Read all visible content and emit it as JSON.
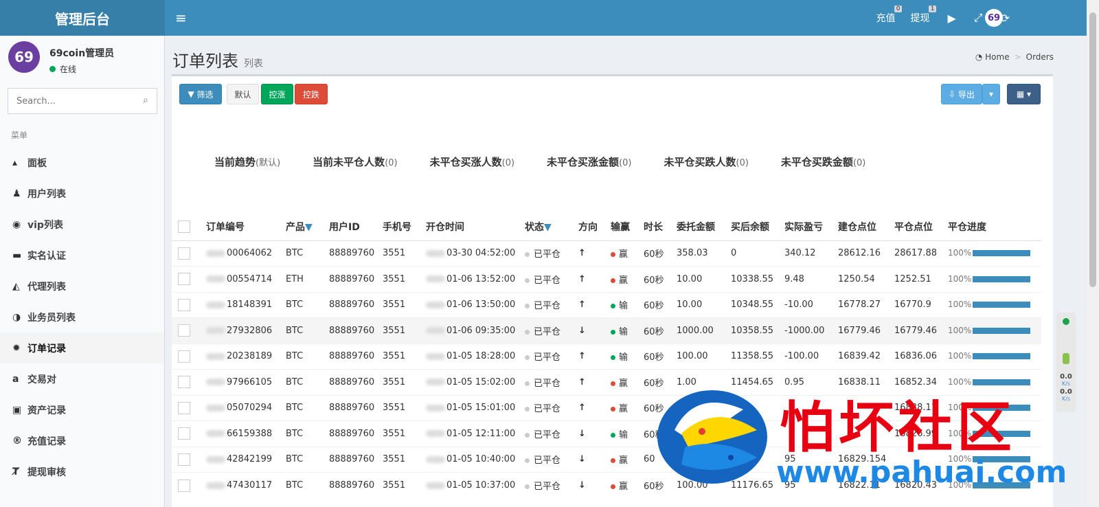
{
  "brand": "管理后台",
  "topnav": {
    "recharge_label": "充值",
    "recharge_badge": "0",
    "withdraw_label": "提现",
    "withdraw_badge": "1",
    "avatar": "69"
  },
  "user": {
    "avatar": "69",
    "name": "69coin管理员",
    "status": "在线"
  },
  "search": {
    "placeholder": "Search..."
  },
  "menu_header": "菜单",
  "menu": [
    {
      "label": "面板",
      "icon": "area-chart-icon"
    },
    {
      "label": "用户列表",
      "icon": "users-icon"
    },
    {
      "label": "vip列表",
      "icon": "chevron-circle-icon"
    },
    {
      "label": "实名认证",
      "icon": "id-card-icon"
    },
    {
      "label": "代理列表",
      "icon": "arrow-circle-up-icon"
    },
    {
      "label": "业务员列表",
      "icon": "half-circle-icon"
    },
    {
      "label": "订单记录",
      "icon": "gear-icon"
    },
    {
      "label": "交易对",
      "icon": "amazon-icon"
    },
    {
      "label": "资产记录",
      "icon": "money-icon"
    },
    {
      "label": "充值记录",
      "icon": "registered-icon"
    },
    {
      "label": "提现审核",
      "icon": "text-height-icon"
    }
  ],
  "page": {
    "title": "订单列表",
    "subtitle": "列表"
  },
  "breadcrumb": {
    "home": "Home",
    "current": "Orders"
  },
  "toolbar": {
    "filter": "筛选",
    "default": "默认",
    "up": "控涨",
    "down": "控跌",
    "export": "导出"
  },
  "stats": [
    {
      "label": "当前趋势",
      "value": "(默认)"
    },
    {
      "label": "当前未平仓人数",
      "value": "(0)"
    },
    {
      "label": "未平仓买涨人数",
      "value": "(0)"
    },
    {
      "label": "未平仓买涨金额",
      "value": "(0)"
    },
    {
      "label": "未平仓买跌人数",
      "value": "(0)"
    },
    {
      "label": "未平仓买跌金额",
      "value": "(0)"
    }
  ],
  "table": {
    "headers": [
      "订单编号",
      "产品",
      "用户ID",
      "手机号",
      "开仓时间",
      "状态",
      "方向",
      "输赢",
      "时长",
      "委托金额",
      "买后余额",
      "实际盈亏",
      "建仓点位",
      "平仓点位",
      "平仓进度"
    ],
    "rows": [
      {
        "id": "00064062",
        "product": "BTC",
        "uid": "88889760",
        "phone": "3551",
        "time": "03-30 04:52:00",
        "status": "已平仓",
        "dir": "↑",
        "result": "赢",
        "dur": "60秒",
        "amount": "358.03",
        "balance": "0",
        "pnl": "340.12",
        "open": "28612.16",
        "close": "28617.88",
        "progress": "100%"
      },
      {
        "id": "00554714",
        "product": "ETH",
        "uid": "88889760",
        "phone": "3551",
        "time": "01-06 13:52:00",
        "status": "已平仓",
        "dir": "↑",
        "result": "赢",
        "dur": "60秒",
        "amount": "10.00",
        "balance": "10338.55",
        "pnl": "9.48",
        "open": "1250.54",
        "close": "1252.51",
        "progress": "100%"
      },
      {
        "id": "18148391",
        "product": "BTC",
        "uid": "88889760",
        "phone": "3551",
        "time": "01-06 13:50:00",
        "status": "已平仓",
        "dir": "↑",
        "result": "输",
        "dur": "60秒",
        "amount": "10.00",
        "balance": "10348.55",
        "pnl": "-10.00",
        "open": "16778.27",
        "close": "16770.9",
        "progress": "100%"
      },
      {
        "id": "27932806",
        "product": "BTC",
        "uid": "88889760",
        "phone": "3551",
        "time": "01-06 09:35:00",
        "status": "已平仓",
        "dir": "↓",
        "result": "输",
        "dur": "60秒",
        "amount": "1000.00",
        "balance": "10358.55",
        "pnl": "-1000.00",
        "open": "16779.46",
        "close": "16779.46",
        "progress": "100%"
      },
      {
        "id": "20238189",
        "product": "BTC",
        "uid": "88889760",
        "phone": "3551",
        "time": "01-05 18:28:00",
        "status": "已平仓",
        "dir": "↑",
        "result": "输",
        "dur": "60秒",
        "amount": "100.00",
        "balance": "11358.55",
        "pnl": "-100.00",
        "open": "16839.42",
        "close": "16836.06",
        "progress": "100%"
      },
      {
        "id": "97966105",
        "product": "BTC",
        "uid": "88889760",
        "phone": "3551",
        "time": "01-05 15:02:00",
        "status": "已平仓",
        "dir": "↑",
        "result": "赢",
        "dur": "60秒",
        "amount": "1.00",
        "balance": "11454.65",
        "pnl": "0.95",
        "open": "16838.11",
        "close": "16852.34",
        "progress": "100%"
      },
      {
        "id": "05070294",
        "product": "BTC",
        "uid": "88889760",
        "phone": "3551",
        "time": "01-05 15:01:00",
        "status": "已平仓",
        "dir": "↑",
        "result": "赢",
        "dur": "60秒",
        "amount": "",
        "balance": "",
        "pnl": "",
        "open": "",
        "close": "16838.11",
        "progress": "100%"
      },
      {
        "id": "66159388",
        "product": "BTC",
        "uid": "88889760",
        "phone": "3551",
        "time": "01-05 12:11:00",
        "status": "已平仓",
        "dir": "↓",
        "result": "输",
        "dur": "60秒",
        "amount": "",
        "balance": "",
        "pnl": "",
        "open": "",
        "close": "16826.99",
        "progress": "100%"
      },
      {
        "id": "42842199",
        "product": "BTC",
        "uid": "88889760",
        "phone": "3551",
        "time": "01-05 10:40:00",
        "status": "已平仓",
        "dir": "↓",
        "result": "赢",
        "dur": "60",
        "amount": "",
        "balance": "",
        "pnl": "95",
        "open": "16829.154",
        "close": "",
        "progress": "100%"
      },
      {
        "id": "47430117",
        "product": "BTC",
        "uid": "88889760",
        "phone": "3551",
        "time": "01-05 10:37:00",
        "status": "已平仓",
        "dir": "↓",
        "result": "赢",
        "dur": "60秒",
        "amount": "100.00",
        "balance": "11176.65",
        "pnl": "95",
        "open": "16822.11",
        "close": "16820.43",
        "progress": "100%"
      }
    ]
  },
  "side_widget": {
    "v1": "0.0",
    "u1": "K/s",
    "v2": "0.0",
    "u2": "K/s"
  },
  "watermark": {
    "text": "怕坏社区",
    "url": "www.pahuai.com"
  },
  "colors": {
    "header": "#3c8dbc",
    "logo_bg": "#367fa9",
    "win": "#dd4b39",
    "lose": "#00a65a"
  }
}
